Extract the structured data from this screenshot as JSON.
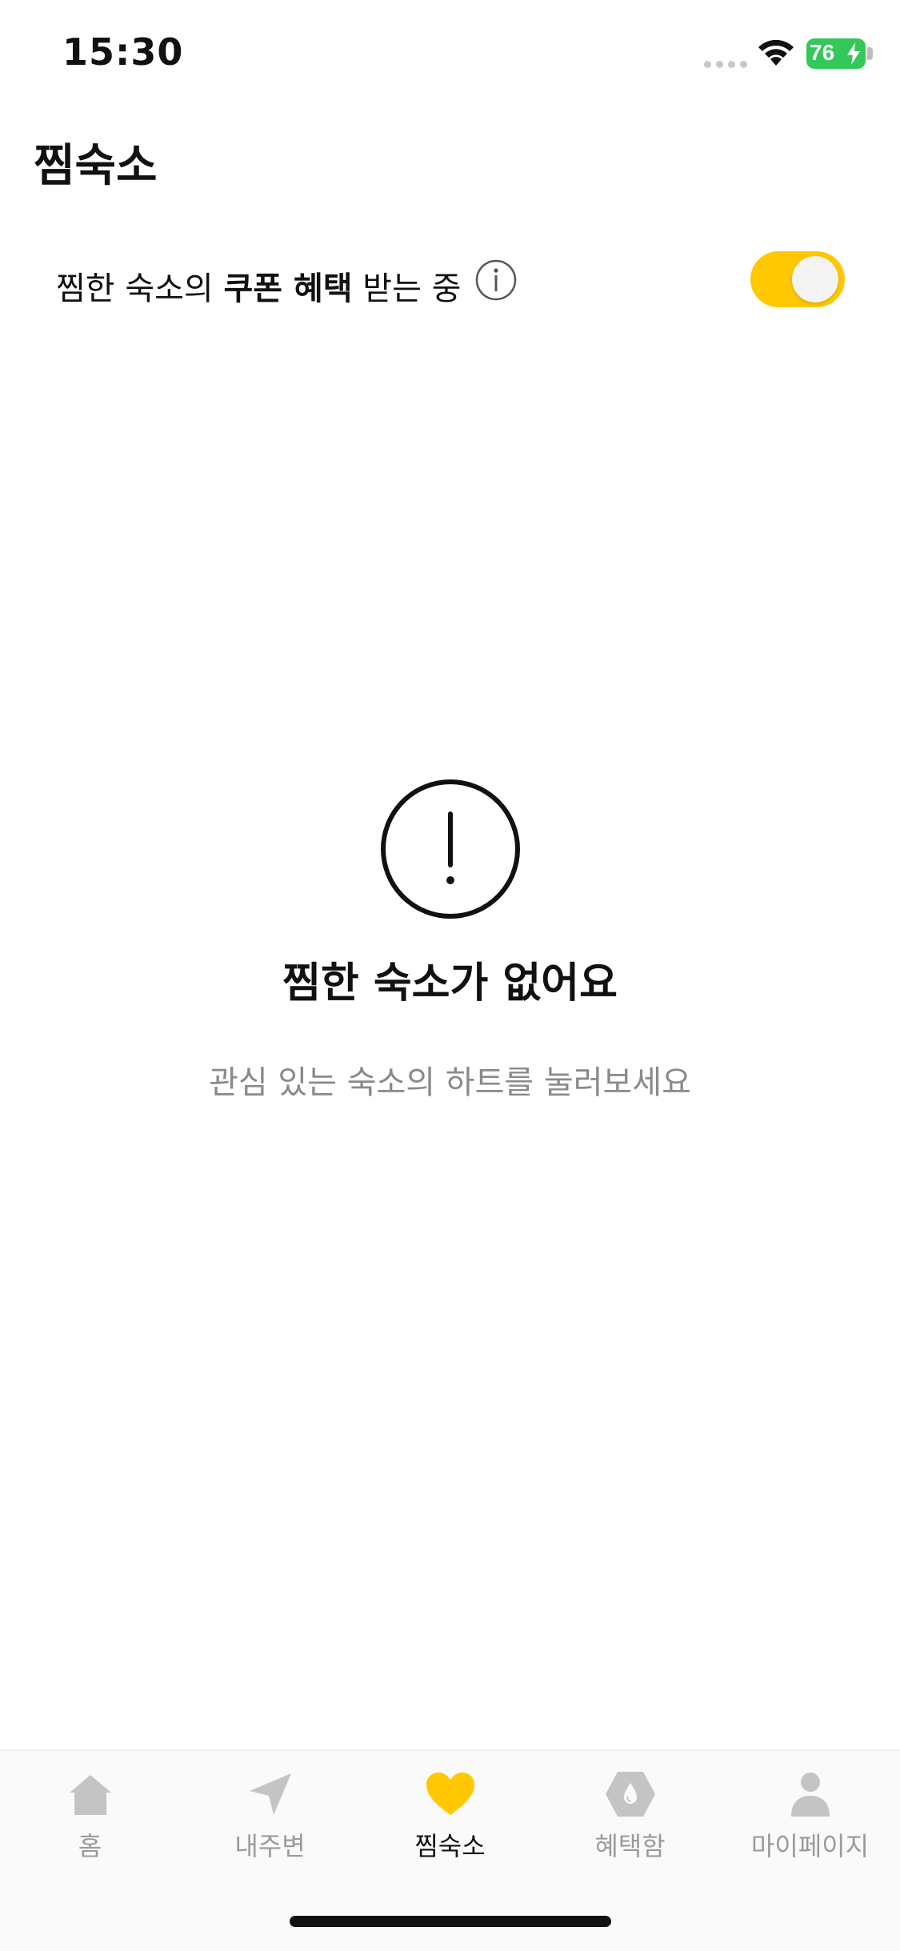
{
  "status_bar": {
    "time": "15:30",
    "battery": "76"
  },
  "header": {
    "title": "찜숙소"
  },
  "coupon": {
    "prefix": "찜한 숙소의 ",
    "highlight": "쿠폰 혜택",
    "suffix": " 받는 중",
    "enabled": true,
    "accent_color": "#ffc800"
  },
  "empty_state": {
    "title": "찜한 숙소가 없어요",
    "subtitle": "관심 있는 숙소의 하트를 눌러보세요",
    "icon": "exclamation-circle-icon"
  },
  "tabs": [
    {
      "label": "홈",
      "icon": "home-icon",
      "active": false
    },
    {
      "label": "내주변",
      "icon": "location-arrow-icon",
      "active": false
    },
    {
      "label": "찜숙소",
      "icon": "heart-icon",
      "active": true
    },
    {
      "label": "혜택함",
      "icon": "benefit-hexagon-icon",
      "active": false
    },
    {
      "label": "마이페이지",
      "icon": "person-icon",
      "active": false
    }
  ]
}
